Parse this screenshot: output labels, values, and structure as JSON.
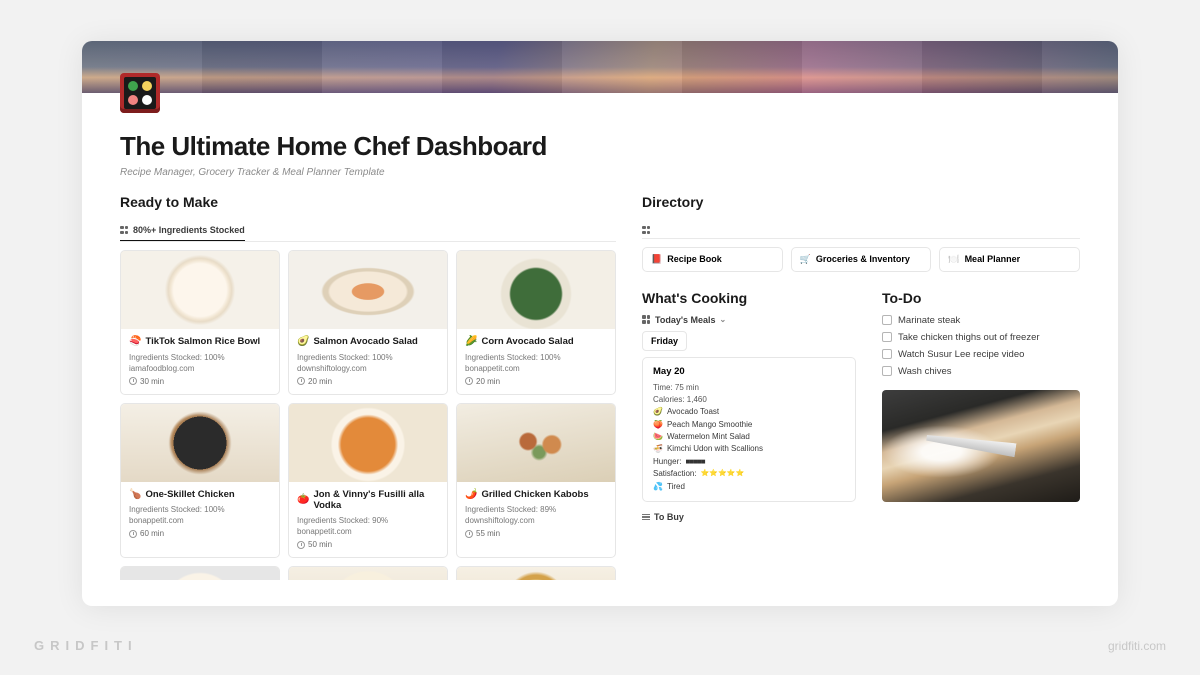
{
  "page": {
    "title": "The Ultimate Home Chef Dashboard",
    "subtitle": "Recipe Manager, Grocery Tracker & Meal Planner Template"
  },
  "ready": {
    "heading": "Ready to Make",
    "view_tab": "80%+ Ingredients Stocked",
    "cards": [
      {
        "emoji": "🍣",
        "title": "TikTok Salmon Rice Bowl",
        "stocked": "Ingredients Stocked: 100%",
        "source": "iamafoodblog.com",
        "time": "30 min"
      },
      {
        "emoji": "🥑",
        "title": "Salmon Avocado Salad",
        "stocked": "Ingredients Stocked: 100%",
        "source": "downshiftology.com",
        "time": "20 min"
      },
      {
        "emoji": "🌽",
        "title": "Corn Avocado Salad",
        "stocked": "Ingredients Stocked: 100%",
        "source": "bonappetit.com",
        "time": "20 min"
      },
      {
        "emoji": "🍗",
        "title": "One-Skillet Chicken",
        "stocked": "Ingredients Stocked: 100%",
        "source": "bonappetit.com",
        "time": "60 min"
      },
      {
        "emoji": "🍅",
        "title": "Jon & Vinny's Fusilli alla Vodka",
        "stocked": "Ingredients Stocked: 90%",
        "source": "bonappetit.com",
        "time": "50 min"
      },
      {
        "emoji": "🌶️",
        "title": "Grilled Chicken Kabobs",
        "stocked": "Ingredients Stocked: 89%",
        "source": "downshiftology.com",
        "time": "55 min"
      }
    ]
  },
  "directory": {
    "heading": "Directory",
    "items": [
      {
        "emoji": "📕",
        "label": "Recipe Book"
      },
      {
        "emoji": "🛒",
        "label": "Groceries & Inventory"
      },
      {
        "emoji": "🍽️",
        "label": "Meal Planner"
      }
    ]
  },
  "cooking": {
    "heading": "What's Cooking",
    "view_tab": "Today's Meals",
    "day": "Friday",
    "date": "May 20",
    "time_label": "Time: 75 min",
    "calories_label": "Calories: 1,460",
    "meals": [
      {
        "emoji": "🥑",
        "name": "Avocado Toast"
      },
      {
        "emoji": "🍑",
        "name": "Peach Mango Smoothie"
      },
      {
        "emoji": "🍉",
        "name": "Watermelon Mint Salad"
      },
      {
        "emoji": "🍜",
        "name": "Kimchi Udon with Scallions"
      }
    ],
    "hunger_label": "Hunger:",
    "hunger_value": "■■■■■",
    "satisfaction_label": "Satisfaction:",
    "satisfaction_value": "⭐⭐⭐⭐⭐",
    "mood_emoji": "💦",
    "mood": "Tired",
    "to_buy": "To Buy"
  },
  "todo": {
    "heading": "To-Do",
    "items": [
      "Marinate steak",
      "Take chicken thighs out of freezer",
      "Watch Susur Lee recipe video",
      "Wash chives"
    ]
  },
  "brand": {
    "left": "GRIDFITI",
    "right": "gridfiti.com"
  }
}
